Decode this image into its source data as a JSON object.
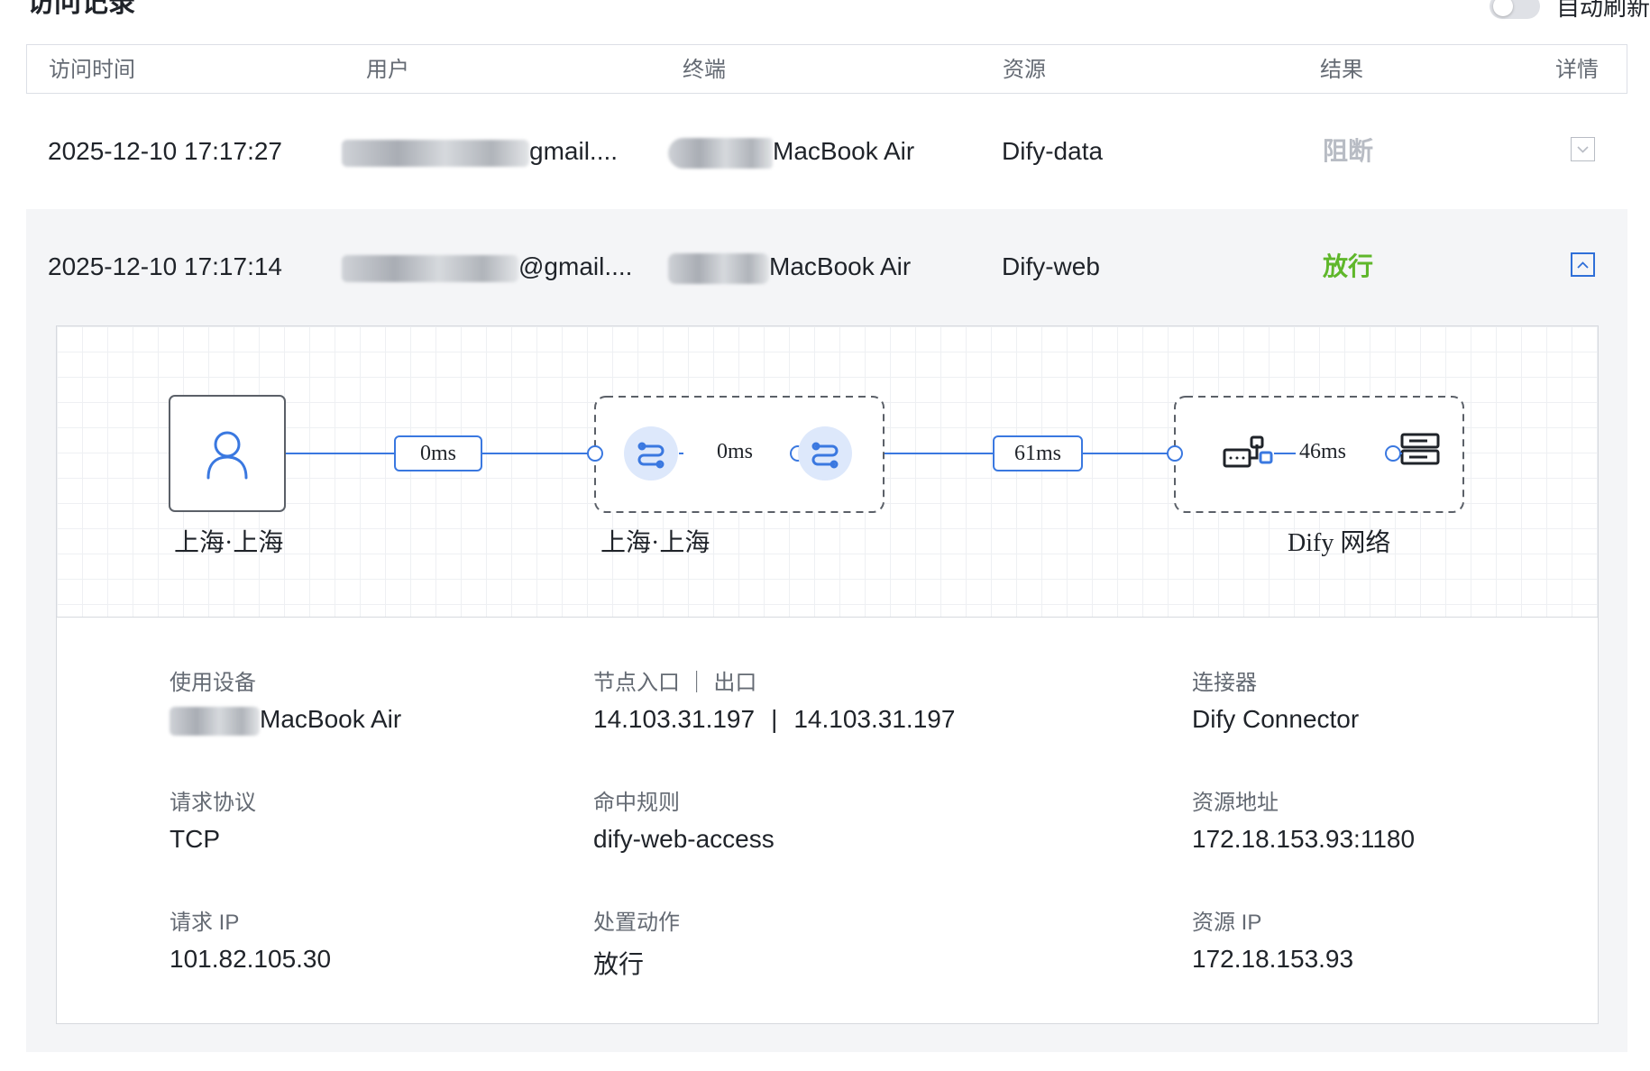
{
  "header": {
    "title": "访问记录",
    "auto_refresh_label": "自动刷新"
  },
  "table": {
    "columns": [
      "访问时间",
      "用户",
      "终端",
      "资源",
      "结果",
      "详情"
    ],
    "rows": [
      {
        "time": "2025-12-10 17:17:27",
        "user_suffix": "gmail....",
        "terminal_suffix": "MacBook Air",
        "resource": "Dify-data",
        "result": "阻断",
        "expanded": false
      },
      {
        "time": "2025-12-10 17:17:14",
        "user_suffix": "@gmail....",
        "terminal_suffix": "MacBook Air",
        "resource": "Dify-web",
        "result": "放行",
        "expanded": true
      }
    ]
  },
  "flow": {
    "user_location": "上海·上海",
    "node_location": "上海·上海",
    "network_name": "Dify 网络",
    "latency_user_to_node": "0ms",
    "latency_in_node": "0ms",
    "latency_node_to_connector": "61ms",
    "latency_connector_to_resource": "46ms"
  },
  "details": {
    "device_label": "使用设备",
    "device_value_suffix": "MacBook Air",
    "node_label": "节点入口 ｜ 出口",
    "node_in": "14.103.31.197",
    "node_sep": "|",
    "node_out": "14.103.31.197",
    "connector_label": "连接器",
    "connector_value": "Dify Connector",
    "protocol_label": "请求协议",
    "protocol_value": "TCP",
    "rule_label": "命中规则",
    "rule_value": "dify-web-access",
    "resource_addr_label": "资源地址",
    "resource_addr_value": "172.18.153.93:1180",
    "request_ip_label": "请求 IP",
    "request_ip_value": "101.82.105.30",
    "action_label": "处置动作",
    "action_value": "放行",
    "resource_ip_label": "资源 IP",
    "resource_ip_value": "172.18.153.93"
  },
  "colors": {
    "allowed": "#5fb72b",
    "blocked": "#b8bcc4",
    "accent": "#2f6fd8"
  }
}
